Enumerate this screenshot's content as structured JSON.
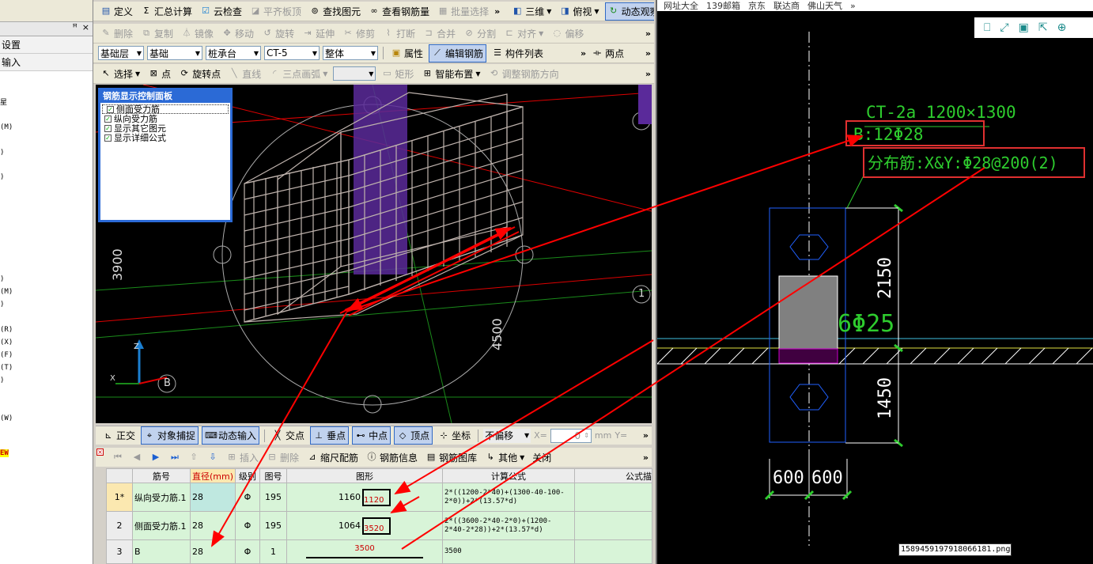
{
  "left_panel": {
    "header_pin": "ꟸ",
    "header_close": "×",
    "rows": [
      "设置",
      "输入"
    ],
    "fragments": [
      "星",
      "(M)",
      ")",
      ")",
      ")",
      "(M)",
      ")",
      "(R)",
      "(X)",
      "(F)",
      "(T)",
      ")",
      "(W)",
      "EW"
    ]
  },
  "toolbar1": {
    "items": [
      "定义",
      "汇总计算",
      "云检查",
      "平齐板顶",
      "查找图元",
      "查看钢筋量",
      "批量选择",
      "三维",
      "俯视",
      "动态观察"
    ]
  },
  "toolbar2": {
    "items": [
      "删除",
      "复制",
      "镜像",
      "移动",
      "旋转",
      "延伸",
      "修剪",
      "打断",
      "合并",
      "分割",
      "对齐",
      "偏移"
    ]
  },
  "toolbar3": {
    "combos": [
      "基础层",
      "基础",
      "桩承台",
      "CT-5",
      "整体"
    ],
    "buttons": [
      "属性",
      "编辑钢筋",
      "构件列表"
    ],
    "right": "两点"
  },
  "toolbar4": {
    "items": [
      "选择",
      "点",
      "旋转点",
      "直线",
      "三点画弧",
      "矩形",
      "智能布置",
      "调整钢筋方向"
    ]
  },
  "control_panel": {
    "title": "钢筋显示控制面板",
    "checks": [
      "侧面受力筋",
      "纵向受力筋",
      "显示其它图元",
      "显示详细公式"
    ]
  },
  "viewport_labels": {
    "dim_3900": "3900",
    "dim_4500": "4500",
    "axis_b": "B",
    "axis_1": "1",
    "axis_z": "Z",
    "axis_x": "X"
  },
  "snap_bar": {
    "items": [
      "正交",
      "对象捕捉",
      "动态输入",
      "交点",
      "垂点",
      "中点",
      "顶点",
      "坐标"
    ],
    "offset_combo": "不偏移",
    "x_label": "X=",
    "x_value": "0",
    "unit": "mm",
    "y_label": "Y="
  },
  "grid_tools": {
    "items": [
      "插入",
      "删除",
      "缩尺配筋",
      "钢筋信息",
      "钢筋图库",
      "其他",
      "关闭"
    ]
  },
  "table": {
    "headers": [
      "",
      "筋号",
      "直径(mm)",
      "级别",
      "图号",
      "图形",
      "计算公式",
      "公式描"
    ],
    "rows": [
      {
        "no": "1*",
        "name": "纵向受力筋.1",
        "dia": "28",
        "grade": "Φ",
        "fig": "195",
        "len_a": "1160",
        "len_b": "1120",
        "formula": "2*((1200-2*40)+(1300-40-100-2*0))+2*(13.57*d)"
      },
      {
        "no": "2",
        "name": "侧面受力筋.1",
        "dia": "28",
        "grade": "Φ",
        "fig": "195",
        "len_a": "1064",
        "len_b": "3520",
        "formula": "2*((3600-2*40-2*0)+(1200-2*40-2*28))+2*(13.57*d)"
      },
      {
        "no": "3",
        "name": "B",
        "dia": "28",
        "grade": "Φ",
        "fig": "1",
        "len_a": "",
        "len_b": "3500",
        "formula": "3500"
      }
    ]
  },
  "cad": {
    "browser_tabs": [
      "网址大全",
      "139邮箱",
      "京东",
      "联达商",
      "佛山天气"
    ],
    "title_text": "CT-2a 1200×1300",
    "label_b": "B:12Φ28",
    "label_dist": "分布筋:X&Y:Φ28@200(2)",
    "label_6phi": "6Φ25",
    "dim_2150": "2150",
    "dim_1450": "1450",
    "dim_600a": "600",
    "dim_600b": "600",
    "filename": "1589459197918066181.png"
  },
  "colors": {
    "toolbar_bg": "#ece9d8",
    "grid_row_bg": "#d8f4d8",
    "cad_green": "#2ecc2e",
    "red_arrow": "#ff0000",
    "panel_blue": "#2b6ad6"
  }
}
